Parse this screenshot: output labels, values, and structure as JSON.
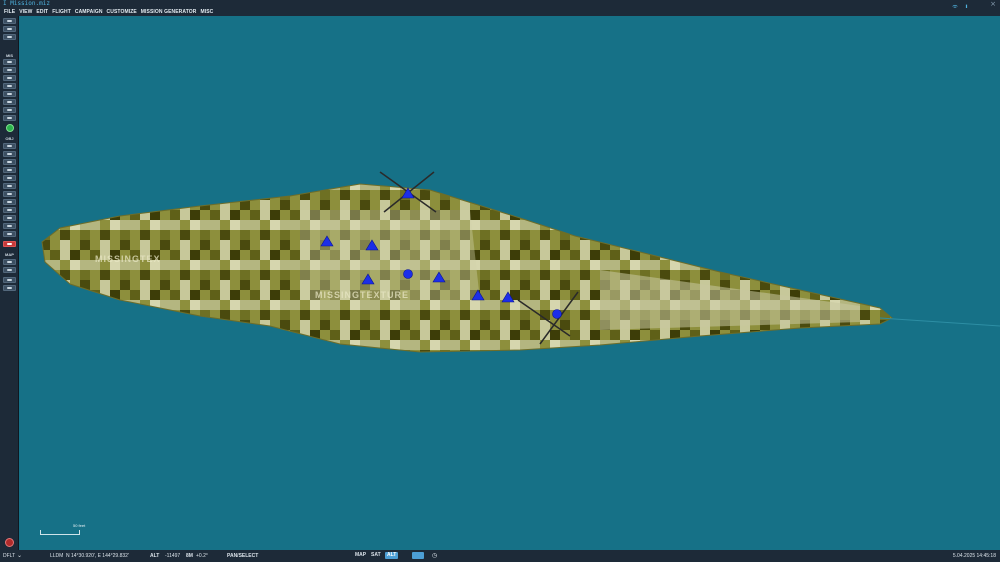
{
  "window": {
    "title": "I Mission.miz",
    "close_glyph": "×"
  },
  "menu": [
    "FILE",
    "VIEW",
    "EDIT",
    "FLIGHT",
    "CAMPAIGN",
    "CUSTOMIZE",
    "MISSION GENERATOR",
    "MISC"
  ],
  "toolbar": {
    "sections": {
      "mis": "MIS",
      "obj": "OBJ",
      "map": "MAP"
    }
  },
  "map": {
    "scale_label": "50 feet",
    "texture_labels": [
      "MISSINGTEX",
      "MISSINGTEXTURE"
    ],
    "colors": {
      "sea": "#167187",
      "unit_blue": "#1c2ee8",
      "camo_light": "#c7c89a",
      "camo_dark": "#4a4a0e",
      "camo_mid": "#8d8f3c"
    }
  },
  "status": {
    "theater": "DFLT",
    "coord_system": "LLDM",
    "coordinates": "N 14°30.920', E 144°29.832'",
    "alt_label": "ALT",
    "alt_value": "-11497",
    "alt_unit": "8M",
    "alt_delta": "+0.2°",
    "mode": "PAN/SELECT",
    "map_modes": [
      "MAP",
      "SAT",
      "ALT"
    ],
    "datetime": "5.04.2025 14:45:18"
  },
  "icons": [
    "wifi-icon",
    "thermometer-icon",
    "close-icon",
    "compass-icon",
    "settings-icon"
  ]
}
